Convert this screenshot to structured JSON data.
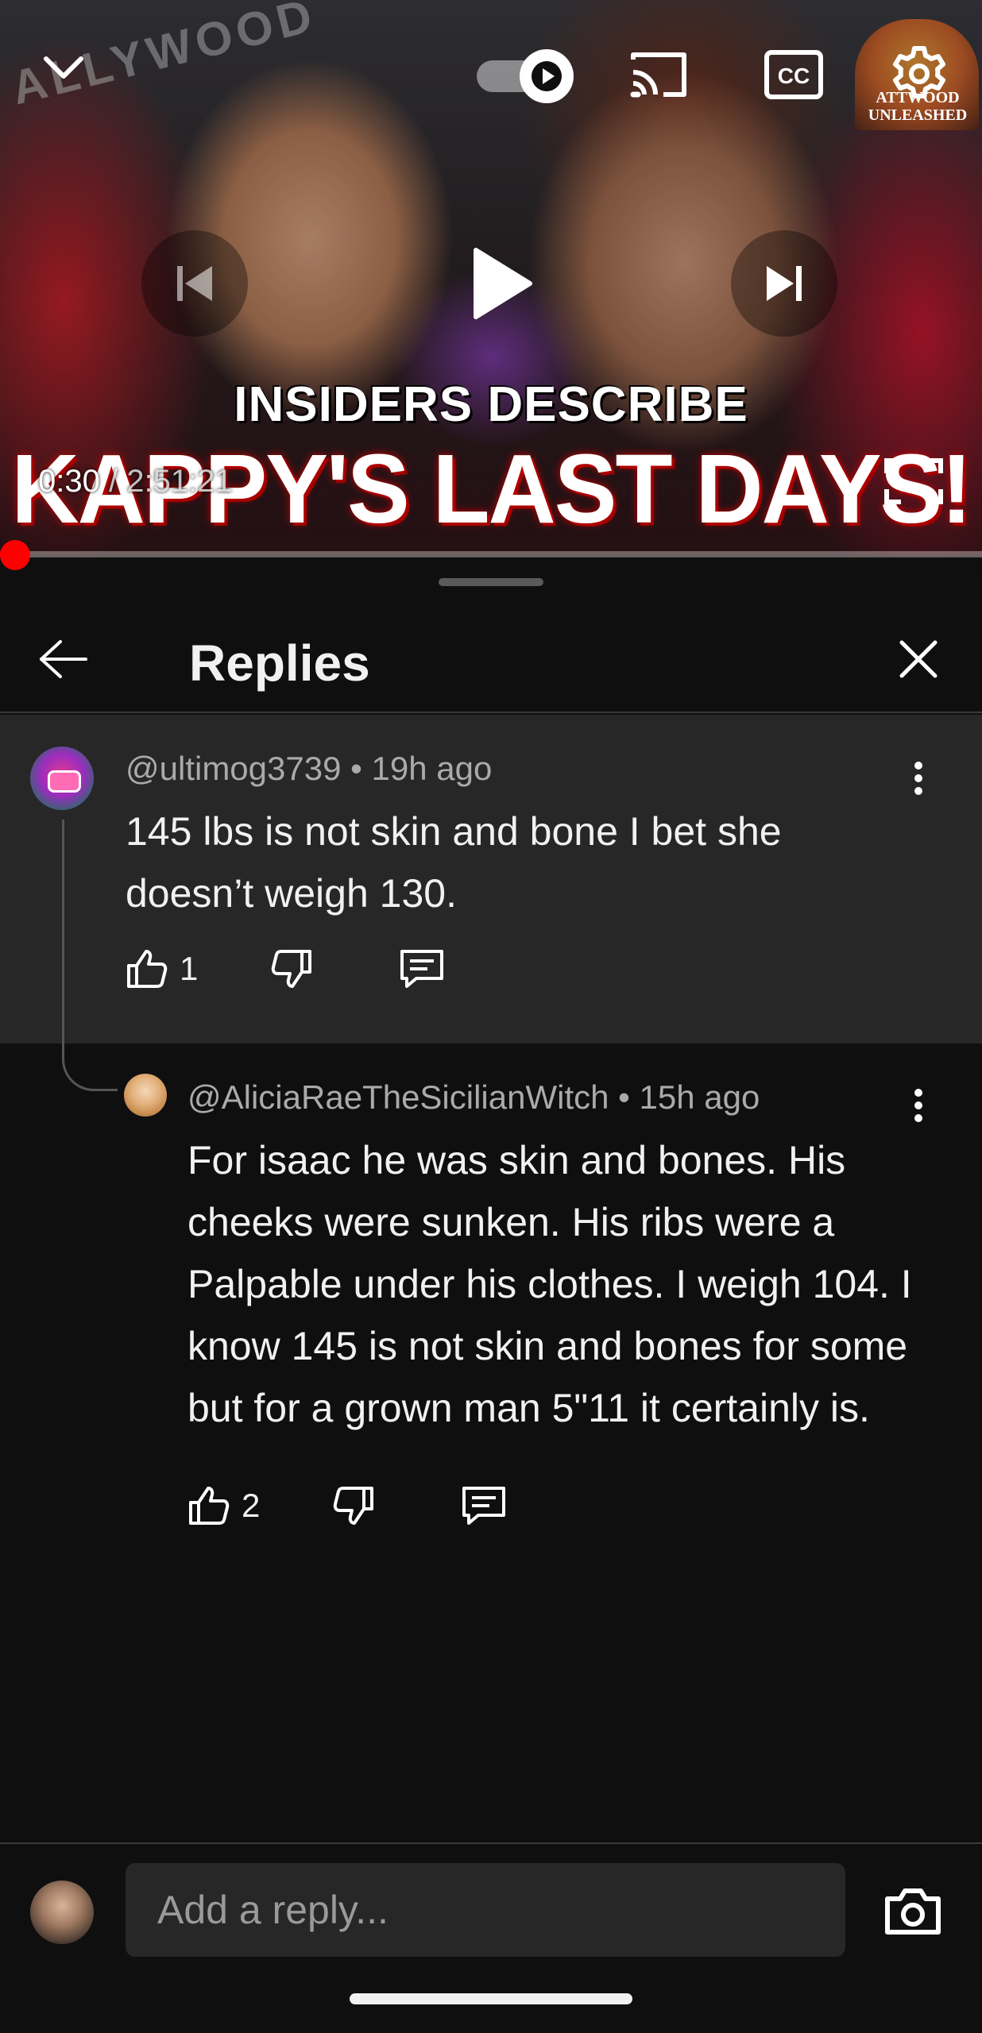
{
  "player": {
    "time_current": "0:30",
    "time_separator": " / ",
    "time_duration": "2:51:21",
    "progress_fraction": 0.003,
    "thumbnail": {
      "headline_line1": "INSIDERS DESCRIBE",
      "headline_line2": "KAPPY'S LAST DAYS!",
      "sign_text": "ALLYWOOD",
      "channel_badge_text": "ATTWOOD UNLEASHED"
    },
    "icons": {
      "collapse": "chevron-down-icon",
      "autoplay": "autoplay-toggle-icon",
      "cast": "cast-icon",
      "captions": "closed-captions-icon",
      "settings": "gear-icon",
      "previous": "skip-previous-icon",
      "play": "play-icon",
      "next": "skip-next-icon",
      "fullscreen": "fullscreen-icon"
    },
    "accent_color": "#ff0000"
  },
  "panel": {
    "title": "Replies",
    "back_icon": "arrow-left-icon",
    "close_icon": "close-icon"
  },
  "parent_comment": {
    "author": "@ultimog3739",
    "separator": " • ",
    "time": "19h ago",
    "text": "145 lbs is not skin and bone I bet she doesn’t weigh 130.",
    "likes": "1"
  },
  "reply": {
    "author": "@AliciaRaeTheSicilianWitch",
    "separator": " • ",
    "time": "15h ago",
    "text": "For isaac he was skin and bones. His cheeks were sunken. His ribs were a Palpable under his clothes. I weigh 104. I know 145 is not skin and bones for some but for a grown man 5\"11 it certainly is.",
    "likes": "2"
  },
  "reply_bar": {
    "placeholder": "Add a reply...",
    "camera_icon": "camera-icon"
  },
  "colors": {
    "background": "#0f0f0f",
    "highlight_row": "#272727",
    "text_primary": "#f1f1f1",
    "text_secondary": "#aaaaaa"
  }
}
